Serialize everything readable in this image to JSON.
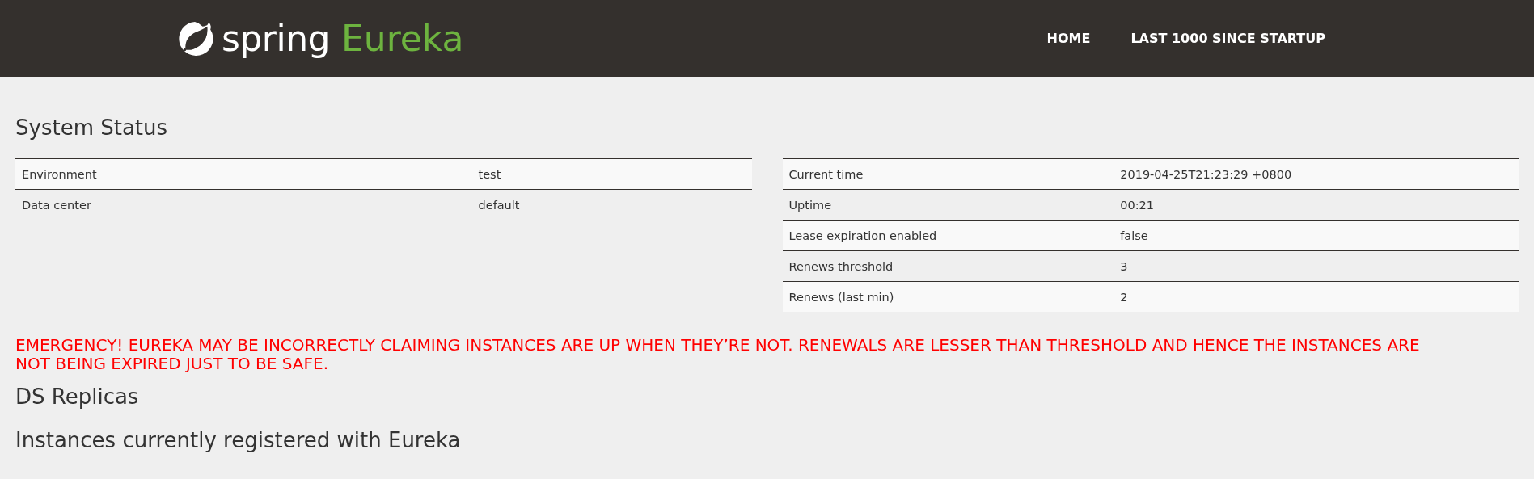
{
  "header": {
    "logo": {
      "brand": "spring",
      "product": "Eureka"
    },
    "nav": [
      {
        "label": "HOME"
      },
      {
        "label": "LAST 1000 SINCE STARTUP"
      }
    ]
  },
  "system_status": {
    "title": "System Status",
    "left_table": [
      {
        "name": "Environment",
        "value": "test"
      },
      {
        "name": "Data center",
        "value": "default"
      }
    ],
    "right_table": [
      {
        "name": "Current time",
        "value": "2019-04-25T21:23:29 +0800"
      },
      {
        "name": "Uptime",
        "value": "00:21"
      },
      {
        "name": "Lease expiration enabled",
        "value": "false"
      },
      {
        "name": "Renews threshold",
        "value": "3"
      },
      {
        "name": "Renews (last min)",
        "value": "2"
      }
    ]
  },
  "emergency": "EMERGENCY! EUREKA MAY BE INCORRECTLY CLAIMING INSTANCES ARE UP WHEN THEY’RE NOT. RENEWALS ARE LESSER THAN THRESHOLD AND HENCE THE INSTANCES ARE NOT BEING EXPIRED JUST TO BE SAFE.",
  "sections": [
    {
      "title": "DS Replicas"
    },
    {
      "title": "Instances currently registered with Eureka"
    }
  ]
}
